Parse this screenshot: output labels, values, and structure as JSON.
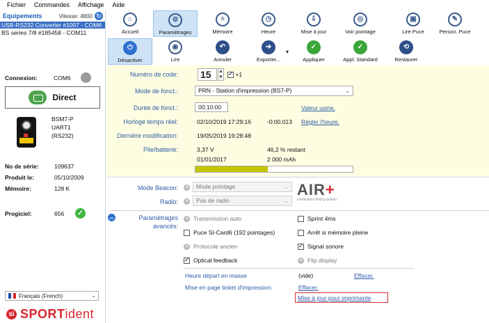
{
  "menu": [
    "Fichier",
    "Commandes",
    "Affichage",
    "Aide"
  ],
  "devices": {
    "title": "Equipements",
    "speed_label": "Vitesse: 4800",
    "selected": "USB-RS232 Converter #1007 - COM6",
    "second": "BS series 7/8 #185458 - COM11"
  },
  "toolbar": {
    "row1": [
      {
        "label": "Accueil",
        "icon": "home-icon"
      },
      {
        "label": "Paramétrages",
        "icon": "settings-icon",
        "active": true
      },
      {
        "label": "Mémoire",
        "icon": "memory-icon"
      },
      {
        "label": "Heure",
        "icon": "clock-icon"
      },
      {
        "label": "Mise à jour",
        "icon": "update-icon"
      },
      {
        "label": "Voir pointage",
        "icon": "view-punch-icon"
      },
      {
        "label": "Lire Puce",
        "icon": "read-chip-icon"
      },
      {
        "label": "Person. Puce",
        "icon": "personalize-chip-icon"
      }
    ],
    "row2": [
      {
        "label": "Désactiver",
        "icon": "deactivate-icon",
        "active": true
      },
      {
        "label": "Lire",
        "icon": "read-icon"
      },
      {
        "label": "Annuler",
        "icon": "undo-icon"
      },
      {
        "label": "Exporter...",
        "icon": "export-icon"
      },
      {
        "label": "Appliquer",
        "icon": "apply-icon"
      },
      {
        "label": "Appl. Standard",
        "icon": "apply-standard-icon"
      },
      {
        "label": "Restaurer",
        "icon": "restore-icon"
      }
    ]
  },
  "left": {
    "connexion_label": "Connexion:",
    "connexion_value": "COM6",
    "direct": "Direct",
    "model_lines": [
      "BSM7-P",
      "UART1",
      "(RS232)"
    ],
    "serial_label": "No de série:",
    "serial_value": "109637",
    "produced_label": "Produit le:",
    "produced_value": "05/10/2009",
    "memory_label": "Mémoire:",
    "memory_value": "128 K",
    "firmware_label": "Progiciel:",
    "firmware_value": "656",
    "language": "Français (French)",
    "brand_prefix": "SPORT",
    "brand_suffix": "ident"
  },
  "form": {
    "code_label": "Numéro de code:",
    "code_value": "15",
    "code_plus": "+1",
    "mode_label": "Mode de fonct.:",
    "mode_value": "PRN - Station d'impression (BS7-P)",
    "duration_label": "Durée de fonct.:",
    "duration_value": "00:10:00",
    "duration_link": "Valeur usine.",
    "clock_label": "Horloge temps réel:",
    "clock_value": "02/10/2019 17:29:16",
    "clock_offset": "-0:00.013",
    "clock_link": "Régler l'heure.",
    "lastmod_label": "Dernière modification:",
    "lastmod_value": "19/05/2019 19:28:48",
    "battery_label": "Pile/batterie:",
    "battery_voltage": "3,37 V",
    "battery_percent_text": "46,2 % restant",
    "battery_date": "01/01/2017",
    "battery_capacity": "2 000 mAh",
    "battery_fraction": 0.462
  },
  "lower": {
    "beacon_label": "Mode Beacon:",
    "beacon_value": "Mode pointage",
    "radio_label": "Radio:",
    "radio_value": "Pas de radio",
    "air_logo": "AIR",
    "air_plus": "+",
    "air_tagline": "contactless timing system",
    "params_label_1": "Paramétrages",
    "params_label_2": "avancés:",
    "options_left": [
      {
        "label": "Transmission auto",
        "state": "disabled"
      },
      {
        "label": "Puce SI-Card6 (192 pointages)",
        "state": "unchecked"
      },
      {
        "label": "Protocole ancien",
        "state": "disabled"
      },
      {
        "label": "Optical feedback",
        "state": "checked"
      }
    ],
    "options_right": [
      {
        "label": "Sprint 4ms",
        "state": "unchecked"
      },
      {
        "label": "Arrêt si mémoire pleine",
        "state": "unchecked"
      },
      {
        "label": "Signal sonore",
        "state": "checked"
      },
      {
        "label": "Flip display",
        "state": "disabled"
      }
    ],
    "mass_start_label": "Heure départ en masse",
    "mass_start_value": "(vide)",
    "mass_start_link": "Effacer.",
    "ticket_label": "Mise en page ticket d'impression:",
    "ticket_link": "Effacer.",
    "printer_update_link": "Mise à jour pour imprimante"
  },
  "colors": {
    "accent": "#2d5aa6",
    "selection": "#3a6fc4",
    "form_bg": "#fdfde2",
    "battery_fill": "#c4c400",
    "brand_red": "#d7282f",
    "ok_green": "#3fb53f"
  }
}
